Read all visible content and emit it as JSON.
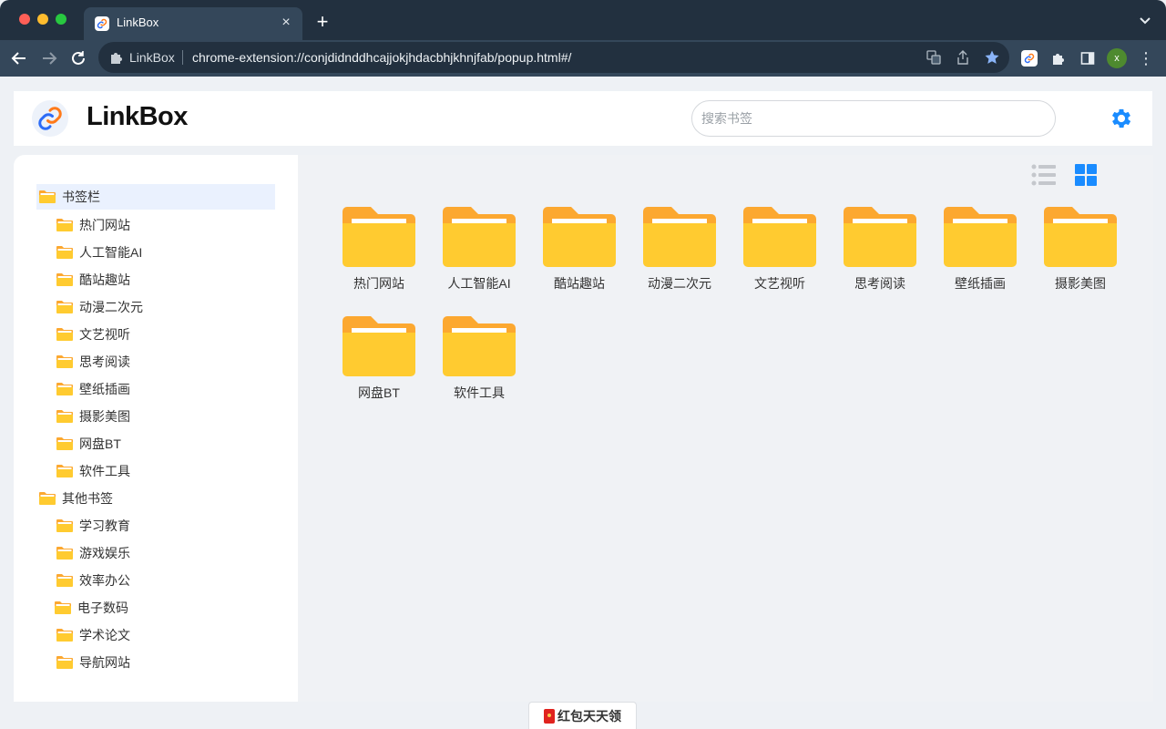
{
  "browser": {
    "tab_title": "LinkBox",
    "tab_close": "×",
    "new_tab": "+",
    "site_name": "LinkBox",
    "url": "chrome-extension://conjdidnddhcajjokjhdacbhjkhnjfab/popup.html#/",
    "profile_initial": "x",
    "menu": "⋮"
  },
  "header": {
    "title": "LinkBox",
    "search_placeholder": "搜索书签"
  },
  "sidebar": {
    "groups": [
      {
        "label": "书签栏",
        "children": [
          "热门网站",
          "人工智能AI",
          "酷站趣站",
          "动漫二次元",
          "文艺视听",
          "思考阅读",
          "壁纸插画",
          "摄影美图",
          "网盘BT",
          "软件工具"
        ]
      },
      {
        "label": "其他书签",
        "children": [
          "学习教育",
          "游戏娱乐",
          "效率办公",
          "电子数码",
          "学术论文",
          "导航网站"
        ]
      }
    ]
  },
  "main": {
    "folders": [
      "热门网站",
      "人工智能AI",
      "酷站趣站",
      "动漫二次元",
      "文艺视听",
      "思考阅读",
      "壁纸插画",
      "摄影美图",
      "网盘BT",
      "软件工具"
    ],
    "view_modes": [
      "list-view-icon",
      "grid-view-icon"
    ],
    "active_view": "grid-view-icon"
  },
  "footer": {
    "promo_label": "红包天天领"
  },
  "colors": {
    "accent": "#1a8cff",
    "folder_back": "#fca830",
    "folder_front": "#ffcb30",
    "folder_paper": "#ffffff",
    "sidebar_active": "#eaf1fe",
    "browser_dark": "#22303f",
    "browser_toolbar": "#34475a"
  }
}
